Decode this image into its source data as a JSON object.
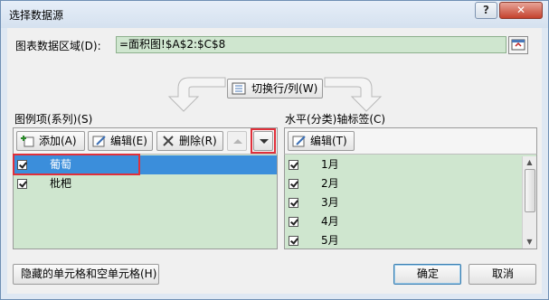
{
  "window": {
    "title": "选择数据源",
    "help_label": "?",
    "close_label": "✕"
  },
  "range": {
    "label": "图表数据区域(D):",
    "value": "=面积图!$A$2:$C$8"
  },
  "switch_button": {
    "label": "切换行/列(W)"
  },
  "legend": {
    "group_label": "图例项(系列)(S)",
    "add_label": "添加(A)",
    "edit_label": "编辑(E)",
    "delete_label": "删除(R)",
    "items": [
      {
        "label": "葡萄",
        "checked": true,
        "selected": true
      },
      {
        "label": "枇杷",
        "checked": true,
        "selected": false
      }
    ]
  },
  "axis": {
    "group_label": "水平(分类)轴标签(C)",
    "edit_label": "编辑(T)",
    "items": [
      {
        "label": "1月",
        "checked": true
      },
      {
        "label": "2月",
        "checked": true
      },
      {
        "label": "3月",
        "checked": true
      },
      {
        "label": "4月",
        "checked": true
      },
      {
        "label": "5月",
        "checked": true
      }
    ]
  },
  "footer": {
    "hidden_cells_label": "隐藏的单元格和空单元格(H)",
    "ok_label": "确定",
    "cancel_label": "取消"
  },
  "colors": {
    "list_bg": "#cfe6cf",
    "selection": "#3b8edb",
    "highlight": "#e0303a"
  },
  "icons": [
    "help-icon",
    "close-icon",
    "range-collapse-icon",
    "switch-row-column-icon",
    "add-icon",
    "edit-icon",
    "delete-icon",
    "move-up-icon",
    "move-down-icon",
    "arrow-left-curve-icon",
    "arrow-right-curve-icon"
  ]
}
